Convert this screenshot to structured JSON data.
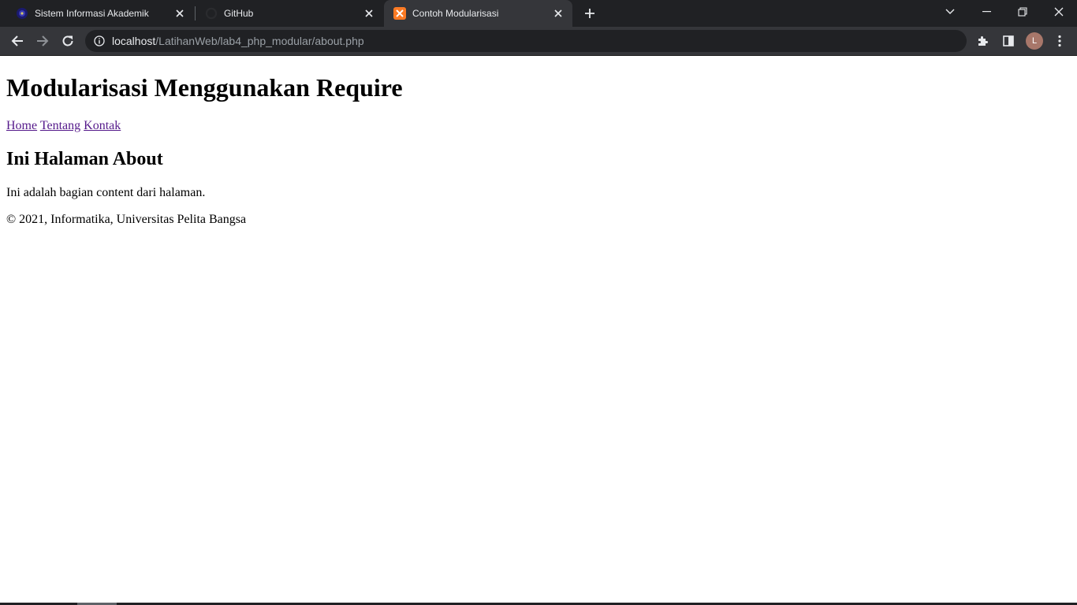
{
  "browser": {
    "tabs": [
      {
        "title": "Sistem Informasi Akademik",
        "active": false,
        "favicon": "university-logo-icon"
      },
      {
        "title": "GitHub",
        "active": false,
        "favicon": "github-icon"
      },
      {
        "title": "Contoh Modularisasi",
        "active": true,
        "favicon": "xampp-icon"
      }
    ],
    "address": {
      "host": "localhost",
      "path": "/LatihanWeb/lab4_php_modular/about.php"
    },
    "profile_initial": "L",
    "colors": {
      "tabstrip": "#202124",
      "toolbar": "#35363a",
      "text": "#e8eaed",
      "xampp": "#fb7a24"
    }
  },
  "page": {
    "title": "Modularisasi Menggunakan Require",
    "nav": [
      {
        "label": "Home"
      },
      {
        "label": "Tentang"
      },
      {
        "label": "Kontak"
      }
    ],
    "heading": "Ini Halaman About",
    "content": "Ini adalah bagian content dari halaman.",
    "footer": "© 2021, Informatika, Universitas Pelita Bangsa",
    "link_color": "#551a8b"
  }
}
